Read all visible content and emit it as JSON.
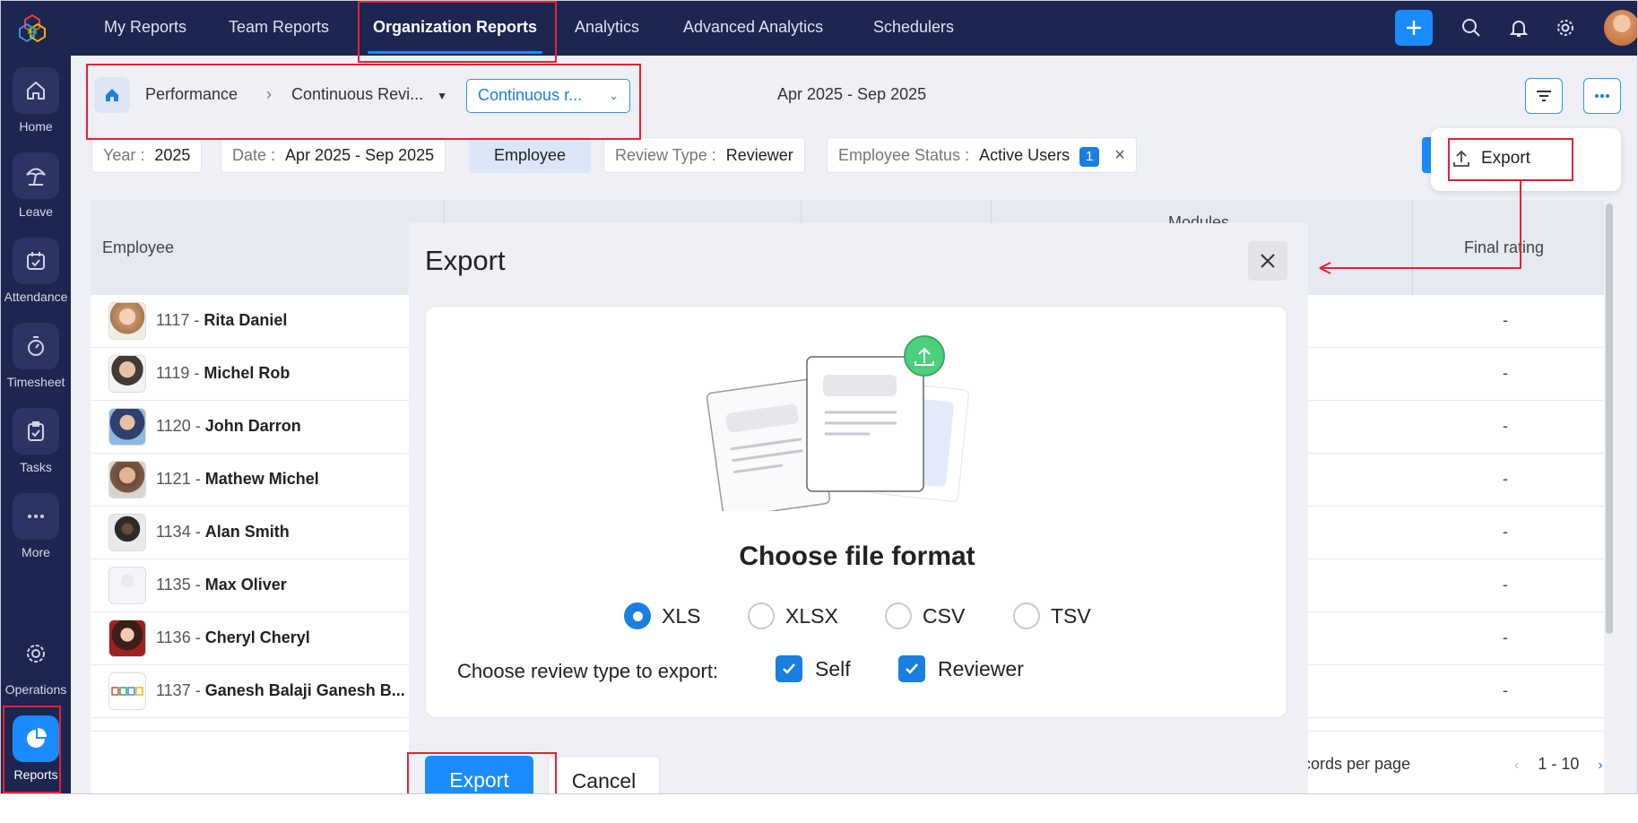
{
  "sidebar": {
    "items": [
      {
        "label": "Home",
        "icon": "home-icon"
      },
      {
        "label": "Leave",
        "icon": "beach-umbrella-icon"
      },
      {
        "label": "Attendance",
        "icon": "calendar-check-icon"
      },
      {
        "label": "Timesheet",
        "icon": "stopwatch-icon"
      },
      {
        "label": "Tasks",
        "icon": "clipboard-check-icon"
      },
      {
        "label": "More",
        "icon": "more-dots-icon"
      },
      {
        "label": "Operations",
        "icon": "gear-cycle-icon"
      },
      {
        "label": "Reports",
        "icon": "pie-chart-icon"
      }
    ]
  },
  "topnav": {
    "tabs": [
      "My Reports",
      "Team Reports",
      "Organization Reports",
      "Analytics",
      "Advanced Analytics",
      "Schedulers"
    ],
    "active_tab": "Organization Reports"
  },
  "breadcrumb": {
    "level1": "Performance",
    "level2": "Continuous Revi...",
    "view_select": "Continuous r...",
    "date_range": "Apr 2025 - Sep 2025"
  },
  "filters": {
    "year_key": "Year :",
    "year_val": "2025",
    "date_key": "Date :",
    "date_val": "Apr 2025 - Sep 2025",
    "employee": "Employee",
    "review_type_key": "Review Type :",
    "review_type_val": "Reviewer",
    "status_key": "Employee Status :",
    "status_val": "Active Users",
    "status_count": "1"
  },
  "export_menu": {
    "label": "Export"
  },
  "table": {
    "col_employee": "Employee",
    "col_modules": "Modules",
    "col_final": "Final rating",
    "rows": [
      {
        "id": "1117 -",
        "name": "Rita Daniel",
        "rating": "-"
      },
      {
        "id": "1119 -",
        "name": "Michel Rob",
        "rating": "-"
      },
      {
        "id": "1120 -",
        "name": "John Darron",
        "rating": "-"
      },
      {
        "id": "1121 -",
        "name": "Mathew Michel",
        "rating": "-"
      },
      {
        "id": "1134 -",
        "name": "Alan Smith",
        "rating": "-"
      },
      {
        "id": "1135 -",
        "name": "Max Oliver",
        "rating": "-"
      },
      {
        "id": "1136 -",
        "name": "Cheryl Cheryl",
        "rating": "-"
      },
      {
        "id": "1137 -",
        "name": "Ganesh Balaji Ganesh B...",
        "rating": "-"
      }
    ],
    "records_per_page": "cords per page",
    "page_range": "1 - 10"
  },
  "modal": {
    "title": "Export",
    "choose_format": "Choose file format",
    "formats": [
      "XLS",
      "XLSX",
      "CSV",
      "TSV"
    ],
    "selected_format": "XLS",
    "review_label": "Choose review type to export:",
    "review_types": [
      "Self",
      "Reviewer"
    ],
    "export_label": "Export",
    "cancel_label": "Cancel"
  },
  "colors": {
    "sidebar_bg": "#1d2551",
    "accent": "#1a8cff",
    "annotation_red": "#e52330",
    "upload_green": "#4cd07d"
  }
}
